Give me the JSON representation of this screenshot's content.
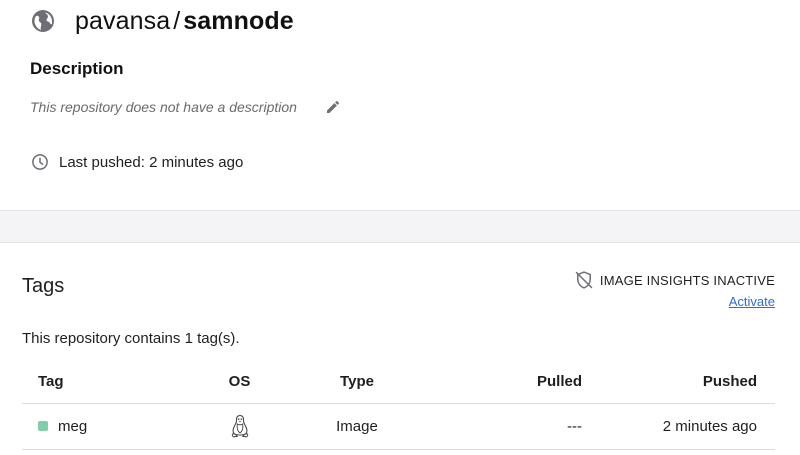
{
  "repo": {
    "owner": "pavansa",
    "separator": "/",
    "name": "samnode",
    "visibility_icon": "globe-icon"
  },
  "description": {
    "heading": "Description",
    "text": "This repository does not have a description"
  },
  "last_pushed": {
    "text": "Last pushed: 2 minutes ago"
  },
  "tags": {
    "heading": "Tags",
    "insights_label": "IMAGE INSIGHTS INACTIVE",
    "activate_label": "Activate",
    "count_text": "This repository contains 1 tag(s).",
    "columns": [
      "Tag",
      "OS",
      "Type",
      "Pulled",
      "Pushed"
    ],
    "rows": [
      {
        "tag": "meg",
        "os_icon": "linux-icon",
        "type": "Image",
        "pulled": "---",
        "pushed": "2 minutes ago",
        "status_color": "#7ccfa8"
      }
    ]
  },
  "colors": {
    "link": "#2a6fd6",
    "band": "#f4f4f6"
  }
}
